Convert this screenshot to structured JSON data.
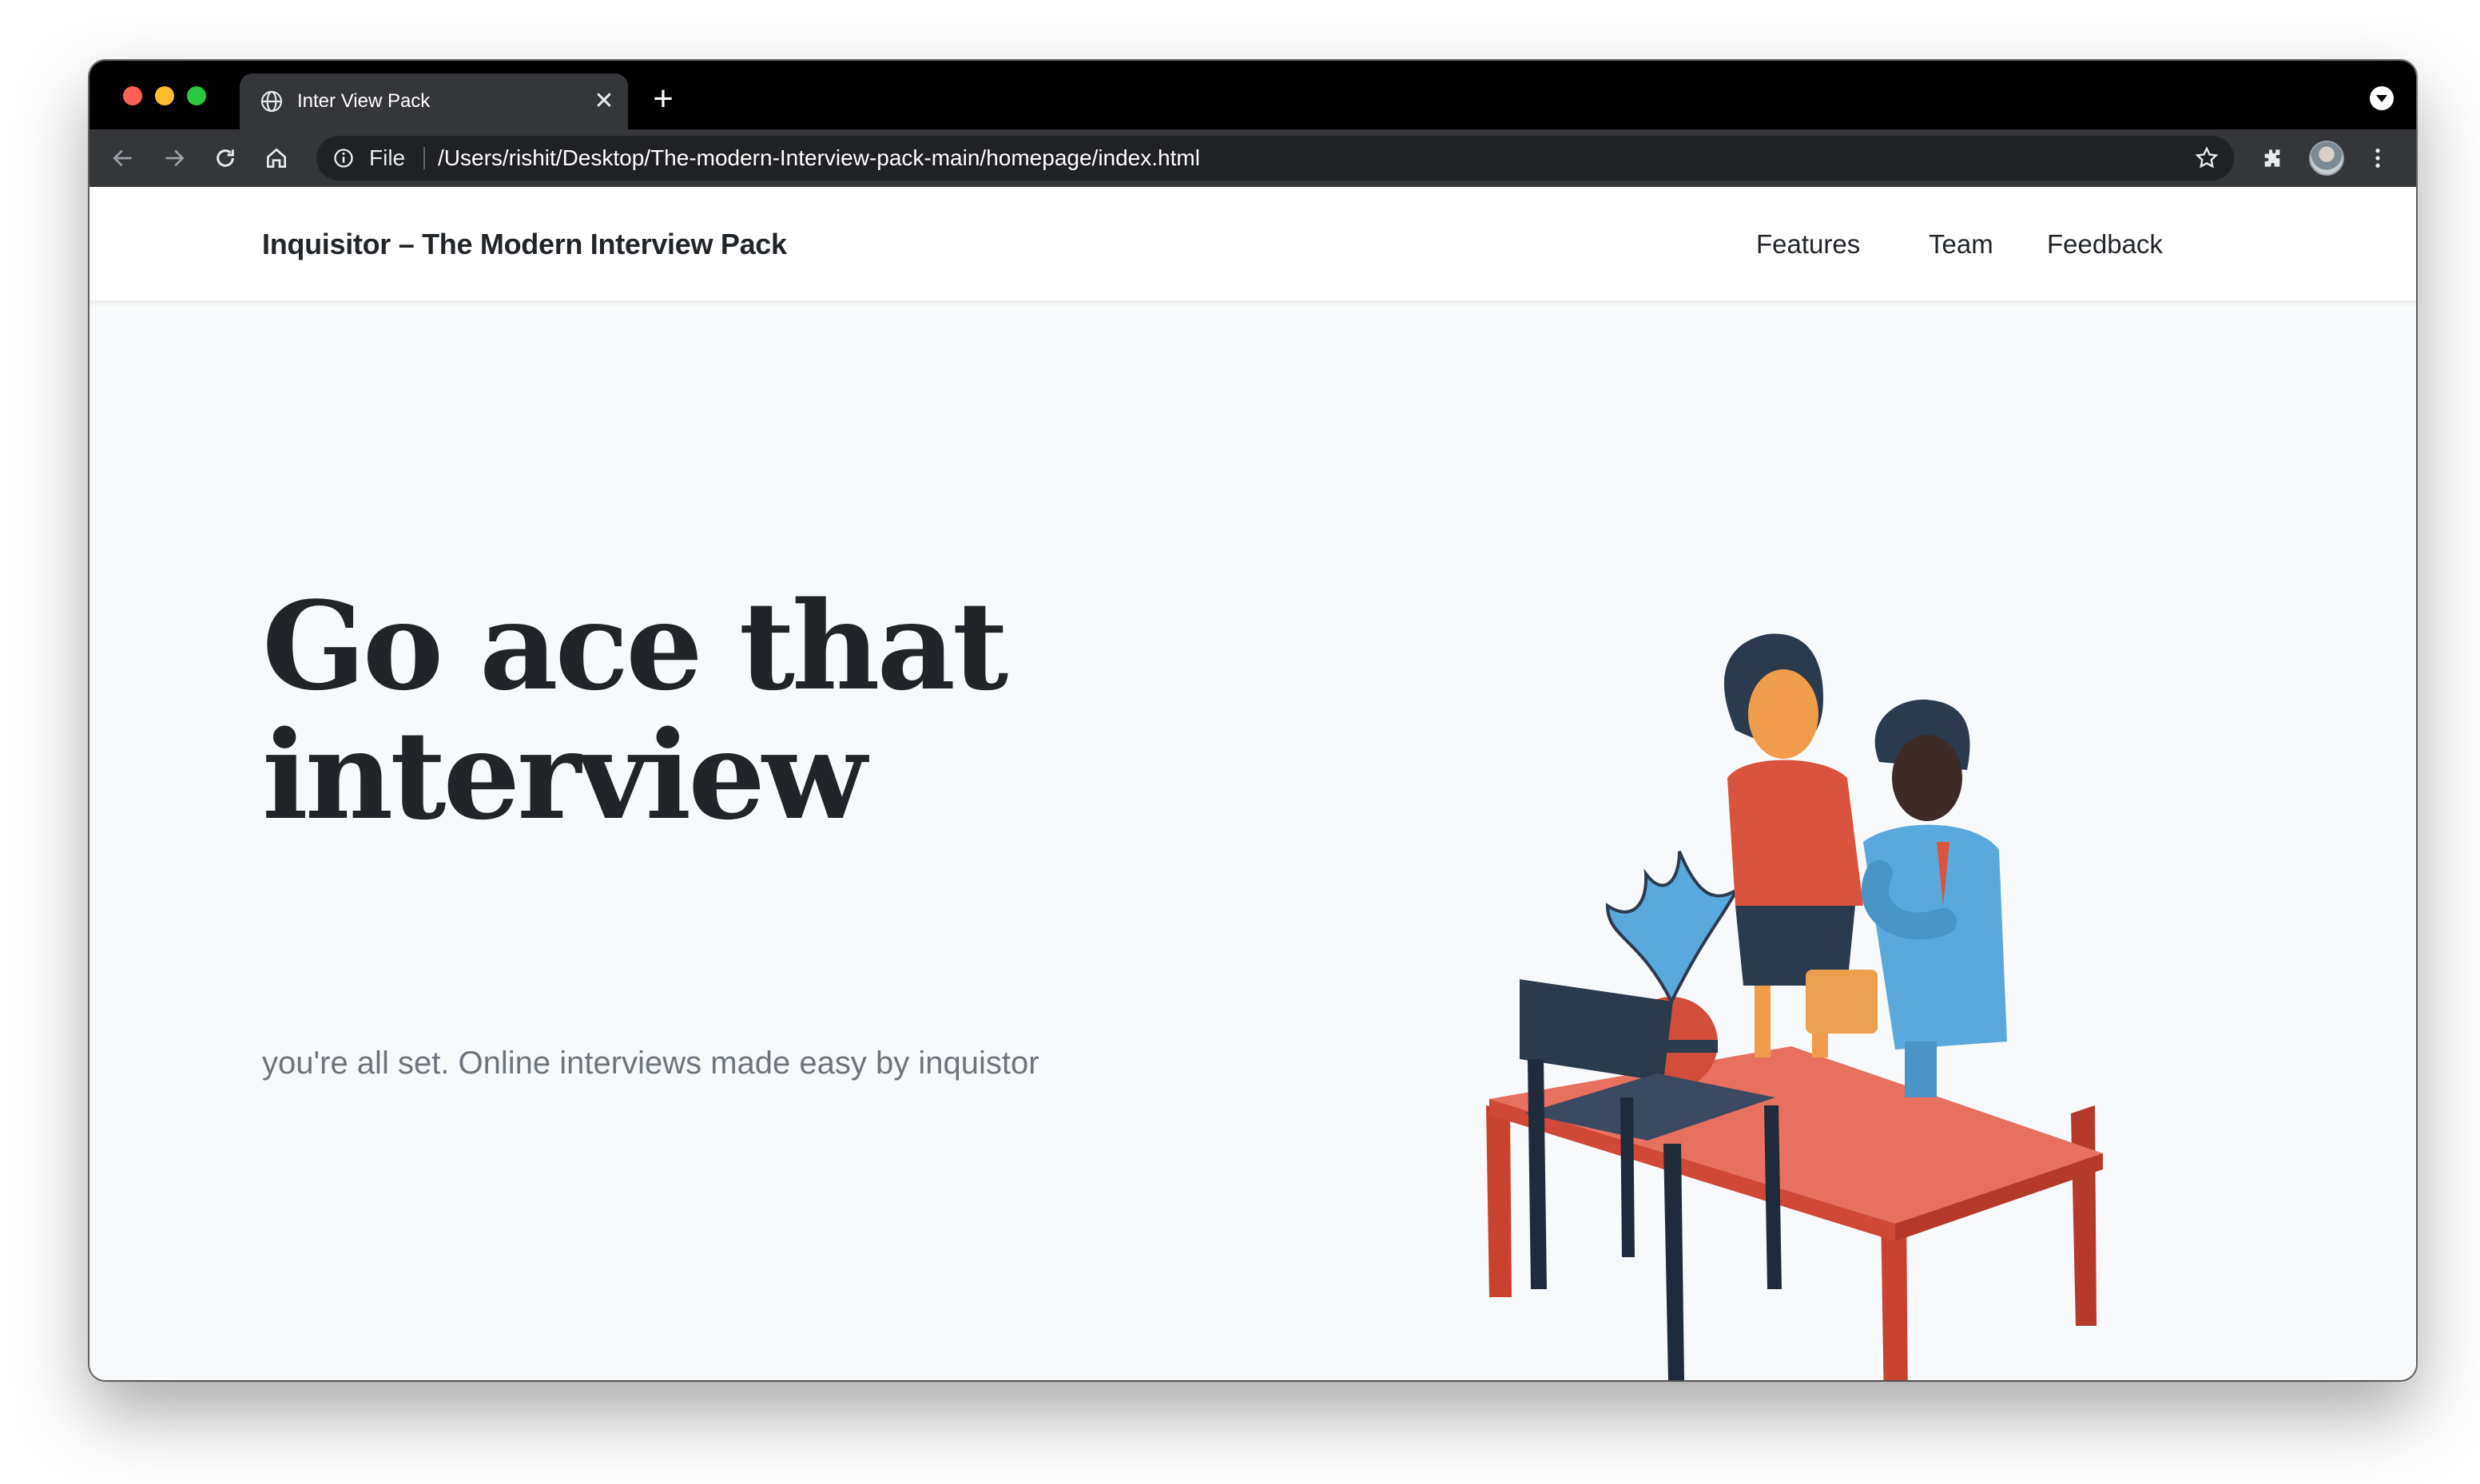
{
  "browser": {
    "tab_title": "Inter View Pack",
    "address_scheme_label": "File",
    "address_url": "/Users/rishit/Desktop/The-modern-Interview-pack-main/homepage/index.html"
  },
  "site": {
    "brand": "Inquisitor – The Modern Interview Pack",
    "nav": [
      {
        "label": "Features"
      },
      {
        "label": "Team"
      },
      {
        "label": "Feedback"
      }
    ]
  },
  "hero": {
    "title_line1": "Go ace that",
    "title_line2": "interview",
    "subtitle": "you're all set. Online interviews made easy by inquistor"
  },
  "colors": {
    "text_dark": "#212529",
    "text_muted": "#6c757d",
    "page_bg": "#f8f9fa",
    "table_red": "#e2503f",
    "chair_navy": "#2b3a4d",
    "suit_blue": "#5aa9dd"
  }
}
